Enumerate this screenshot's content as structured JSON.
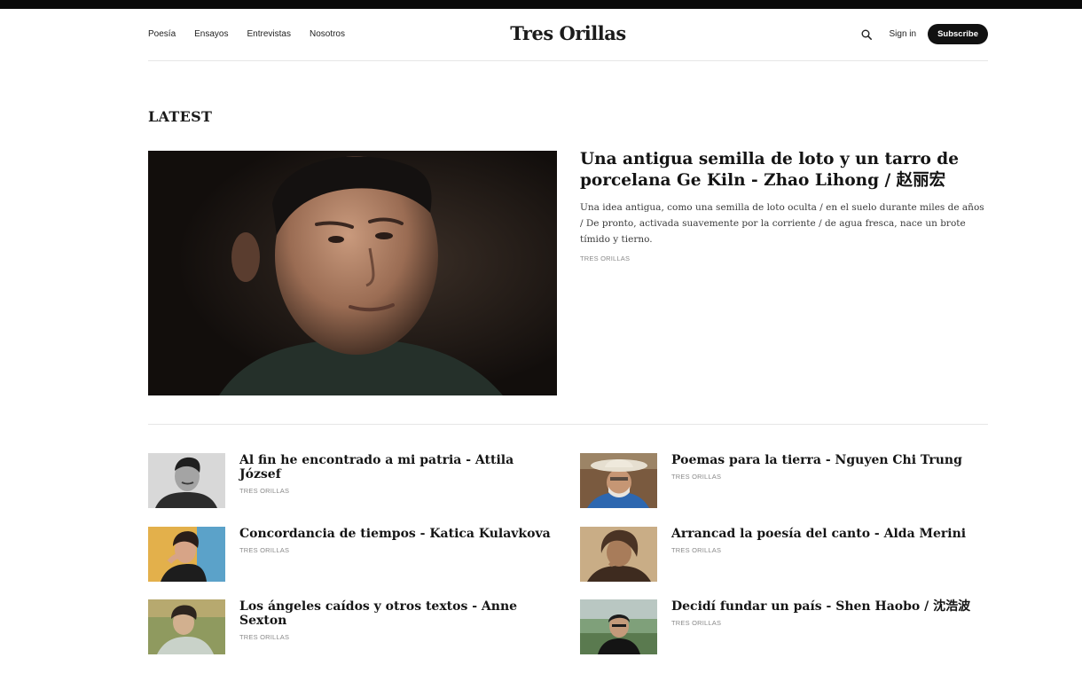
{
  "site": {
    "brand": "Tres Orillas",
    "nav": [
      "Poesía",
      "Ensayos",
      "Entrevistas",
      "Nosotros"
    ],
    "signin_label": "Sign in",
    "subscribe_label": "Subscribe",
    "accent": "#111111"
  },
  "latest": {
    "section_title": "LATEST",
    "featured": {
      "title": "Una antigua semilla de loto y un tarro de porcelana Ge Kiln - Zhao Lihong / 赵丽宏",
      "excerpt": "Una idea antigua, como una semilla de loto oculta / en el suelo durante miles de años / De pronto, activada suavemente por la corriente / de agua fresca, nace un brote tímido y tierno.",
      "author": "TRES ORILLAS"
    },
    "posts_left": [
      {
        "title": "Al fin he encontrado a mi patria - Attila József",
        "author": "TRES ORILLAS"
      },
      {
        "title": "Concordancia de tiempos - Katica Kulavkova",
        "author": "TRES ORILLAS"
      },
      {
        "title": "Los ángeles caídos y otros textos - Anne Sexton",
        "author": "TRES ORILLAS"
      }
    ],
    "posts_right": [
      {
        "title": "Poemas para la tierra - Nguyen Chi Trung",
        "author": "TRES ORILLAS"
      },
      {
        "title": "Arrancad la poesía del canto - Alda Merini",
        "author": "TRES ORILLAS"
      },
      {
        "title": "Decidí fundar un país - Shen Haobo / 沈浩波",
        "author": "TRES ORILLAS"
      }
    ]
  }
}
